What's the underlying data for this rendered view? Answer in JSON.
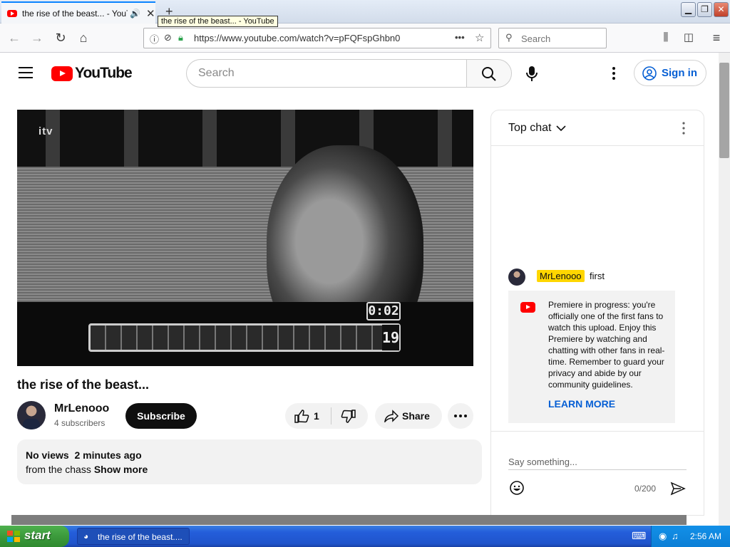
{
  "browser": {
    "tab_title": "the rise of the beast... - YouTube",
    "tooltip": "the rise of the beast... - YouTube",
    "url": "https://www.youtube.com/watch?v=pFQFspGhbn0",
    "search_placeholder": "Search",
    "window_controls": [
      "minimize",
      "restore",
      "close"
    ]
  },
  "youtube": {
    "logo_text": "YouTube",
    "search_placeholder": "Search",
    "sign_in_label": "Sign in"
  },
  "video": {
    "overlay_channel": "itv",
    "overlay_timer": "0:02",
    "overlay_score": "19",
    "title": "the rise of the beast...",
    "channel_name": "MrLenooo",
    "subscribers": "4 subscribers",
    "subscribe_label": "Subscribe",
    "like_count": "1",
    "share_label": "Share",
    "views": "No views",
    "uploaded": "2 minutes ago",
    "description": "from the chass",
    "show_more": "Show more"
  },
  "chat": {
    "title": "Top chat",
    "message": {
      "author": "MrLenooo",
      "text": "first"
    },
    "premiere_notice": "Premiere in progress: you're officially one of the first fans to watch this upload. Enjoy this Premiere by watching and chatting with other fans in real-time. Remember to guard your privacy and abide by our community guidelines.",
    "learn_more": "LEARN MORE",
    "input_placeholder": "Say something...",
    "char_count": "0/200"
  },
  "taskbar": {
    "start_label": "start",
    "task_label": "the rise of the beast....",
    "clock": "2:56 AM"
  },
  "colors": {
    "youtube_red": "#ff0000",
    "link_blue": "#065fd4",
    "author_badge": "#ffd600",
    "xp_blue": "#245edb",
    "xp_green": "#3c9a3c"
  }
}
